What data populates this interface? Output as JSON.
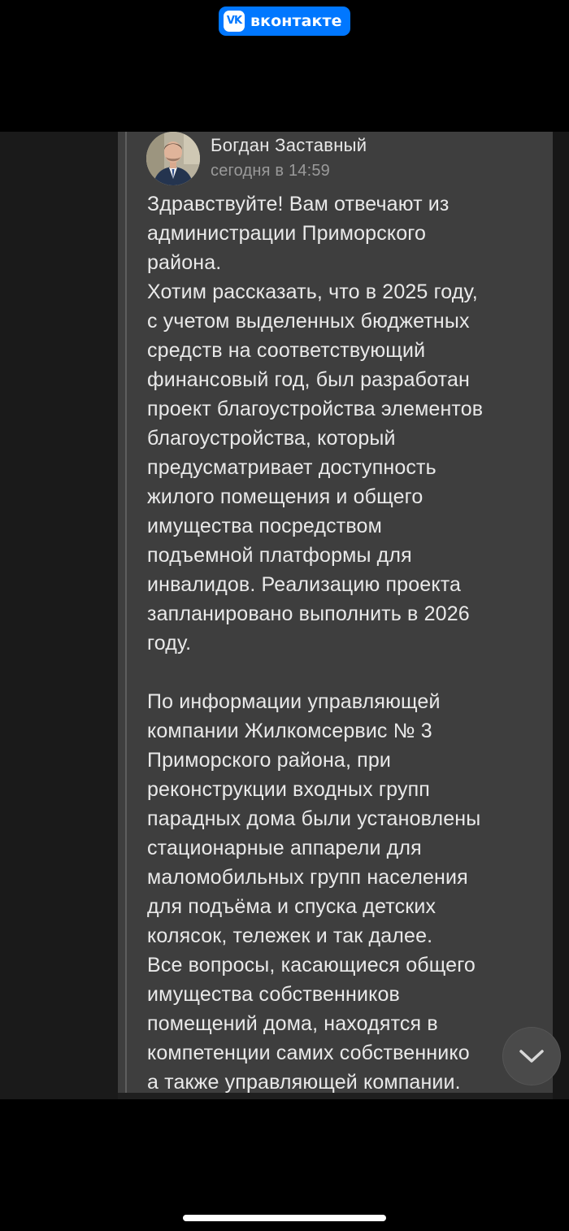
{
  "app_badge": {
    "logo_text": "VK",
    "name": "вконтакте",
    "color": "#0077ff"
  },
  "comment": {
    "author": "Богдан Заставный",
    "time": "сегодня в 14:59",
    "lines": [
      "Здравствуйте! Вам отвечают из",
      "администрации Приморского",
      "района.",
      "Хотим рассказать, что в 2025 году,",
      "с учетом выделенных бюджетных",
      "средств на соответствующий",
      "финансовый год, был разработан",
      "проект благоустройства элементов",
      "благоустройства, который",
      "предусматривает доступность",
      "жилого помещения и общего",
      "имущества посредством",
      "подъемной платформы для",
      "инвалидов. Реализацию проекта",
      "запланировано выполнить в 2026",
      "году.",
      "",
      "По информации управляющей",
      "компании Жилкомсервис № 3",
      "Приморского района, при",
      "реконструкции входных групп",
      "парадных дома были установлены",
      "стационарные аппарели для",
      "маломобильных групп населения",
      "для подъёма и спуска детских",
      "колясок, тележек и так далее.",
      "Все вопросы, касающиеся общего",
      "имущества собственников",
      "помещений дома, находятся в",
      "компетенции самих собственнико",
      "а также управляющей компании."
    ]
  },
  "icons": {
    "scroll_down": "chevron-down-icon",
    "avatar": "user-avatar"
  }
}
